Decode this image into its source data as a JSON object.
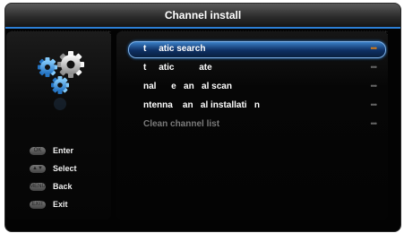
{
  "title": "Channel install",
  "menu": {
    "items": [
      {
        "label": "t     atic search",
        "more": "•••",
        "selected": true,
        "disabled": false
      },
      {
        "label": "t     atic          ate",
        "more": "•••",
        "selected": false,
        "disabled": false
      },
      {
        "label": "nal      e   an   al scan",
        "more": "•••",
        "selected": false,
        "disabled": false
      },
      {
        "label": "ntenna    an   al installati   n",
        "more": "•••",
        "selected": false,
        "disabled": false
      },
      {
        "label": "Clean channel list",
        "more": "•••",
        "selected": false,
        "disabled": true
      }
    ]
  },
  "keys": [
    {
      "icon_text": "OK",
      "label": "Enter",
      "icon": "ok-key-icon"
    },
    {
      "icon_text": "▲▼",
      "label": "Select",
      "icon": "select-key-icon"
    },
    {
      "icon_text": "MENU",
      "label": "Back",
      "icon": "menu-key-icon"
    },
    {
      "icon_text": "EXIT",
      "label": "Exit",
      "icon": "exit-key-icon"
    }
  ],
  "colors": {
    "accent": "#2c7fd6",
    "more_selected": "#d07a1a"
  },
  "icons": {
    "settings": "gears-icon"
  }
}
